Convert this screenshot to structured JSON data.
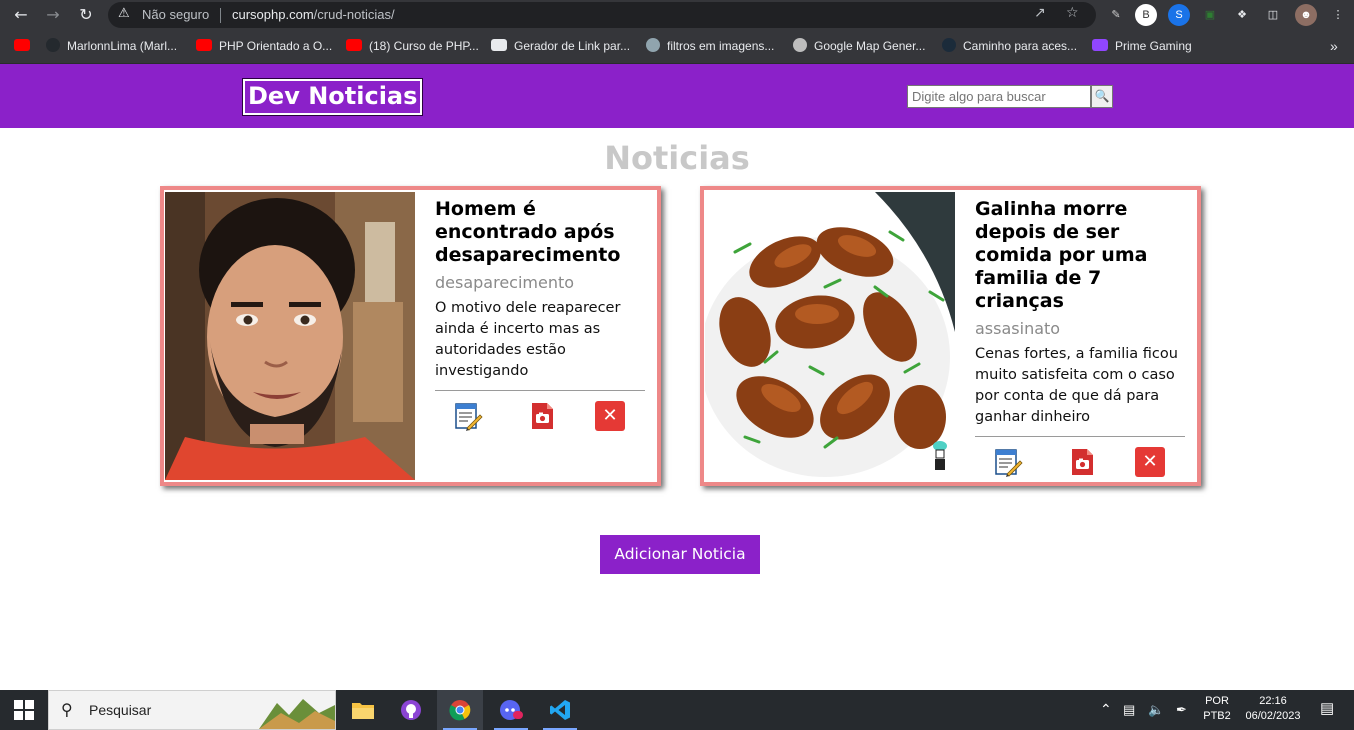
{
  "browser": {
    "omnibox": {
      "security_label": "Não seguro",
      "host": "cursophp.com",
      "path": "/crud-noticias/"
    },
    "profile_initial": "B",
    "bookmarks": [
      {
        "label": "MarlonnLima (Marl..."
      },
      {
        "label": "PHP Orientado a O..."
      },
      {
        "label": "(18) Curso de PHP..."
      },
      {
        "label": "Gerador de Link par..."
      },
      {
        "label": "filtros em imagens..."
      },
      {
        "label": "Google Map Gener..."
      },
      {
        "label": "Caminho para aces..."
      },
      {
        "label": "Prime Gaming"
      }
    ]
  },
  "site": {
    "brand": "Dev Noticias",
    "search": {
      "placeholder": "Digite algo para buscar",
      "value": ""
    },
    "page_title": "Noticias",
    "news": [
      {
        "title": "Homem é encontrado após desaparecimento",
        "category": "desaparecimento",
        "description": "O motivo dele reaparecer ainda é incerto mas as autoridades estão investigando"
      },
      {
        "title": "Galinha morre depois de ser comida por uma familia de 7 crianças",
        "category": "assasinato",
        "description": "Cenas fortes, a familia ficou muito satisfeita com o caso por conta de que dá para ganhar dinheiro"
      }
    ],
    "add_button": "Adicionar Noticia",
    "accent_color": "#8b21c9",
    "card_border_color": "#ee8888"
  },
  "taskbar": {
    "search_text": "Pesquisar",
    "language": "POR",
    "keyboard": "PTB2",
    "time": "22:16",
    "date": "06/02/2023"
  }
}
